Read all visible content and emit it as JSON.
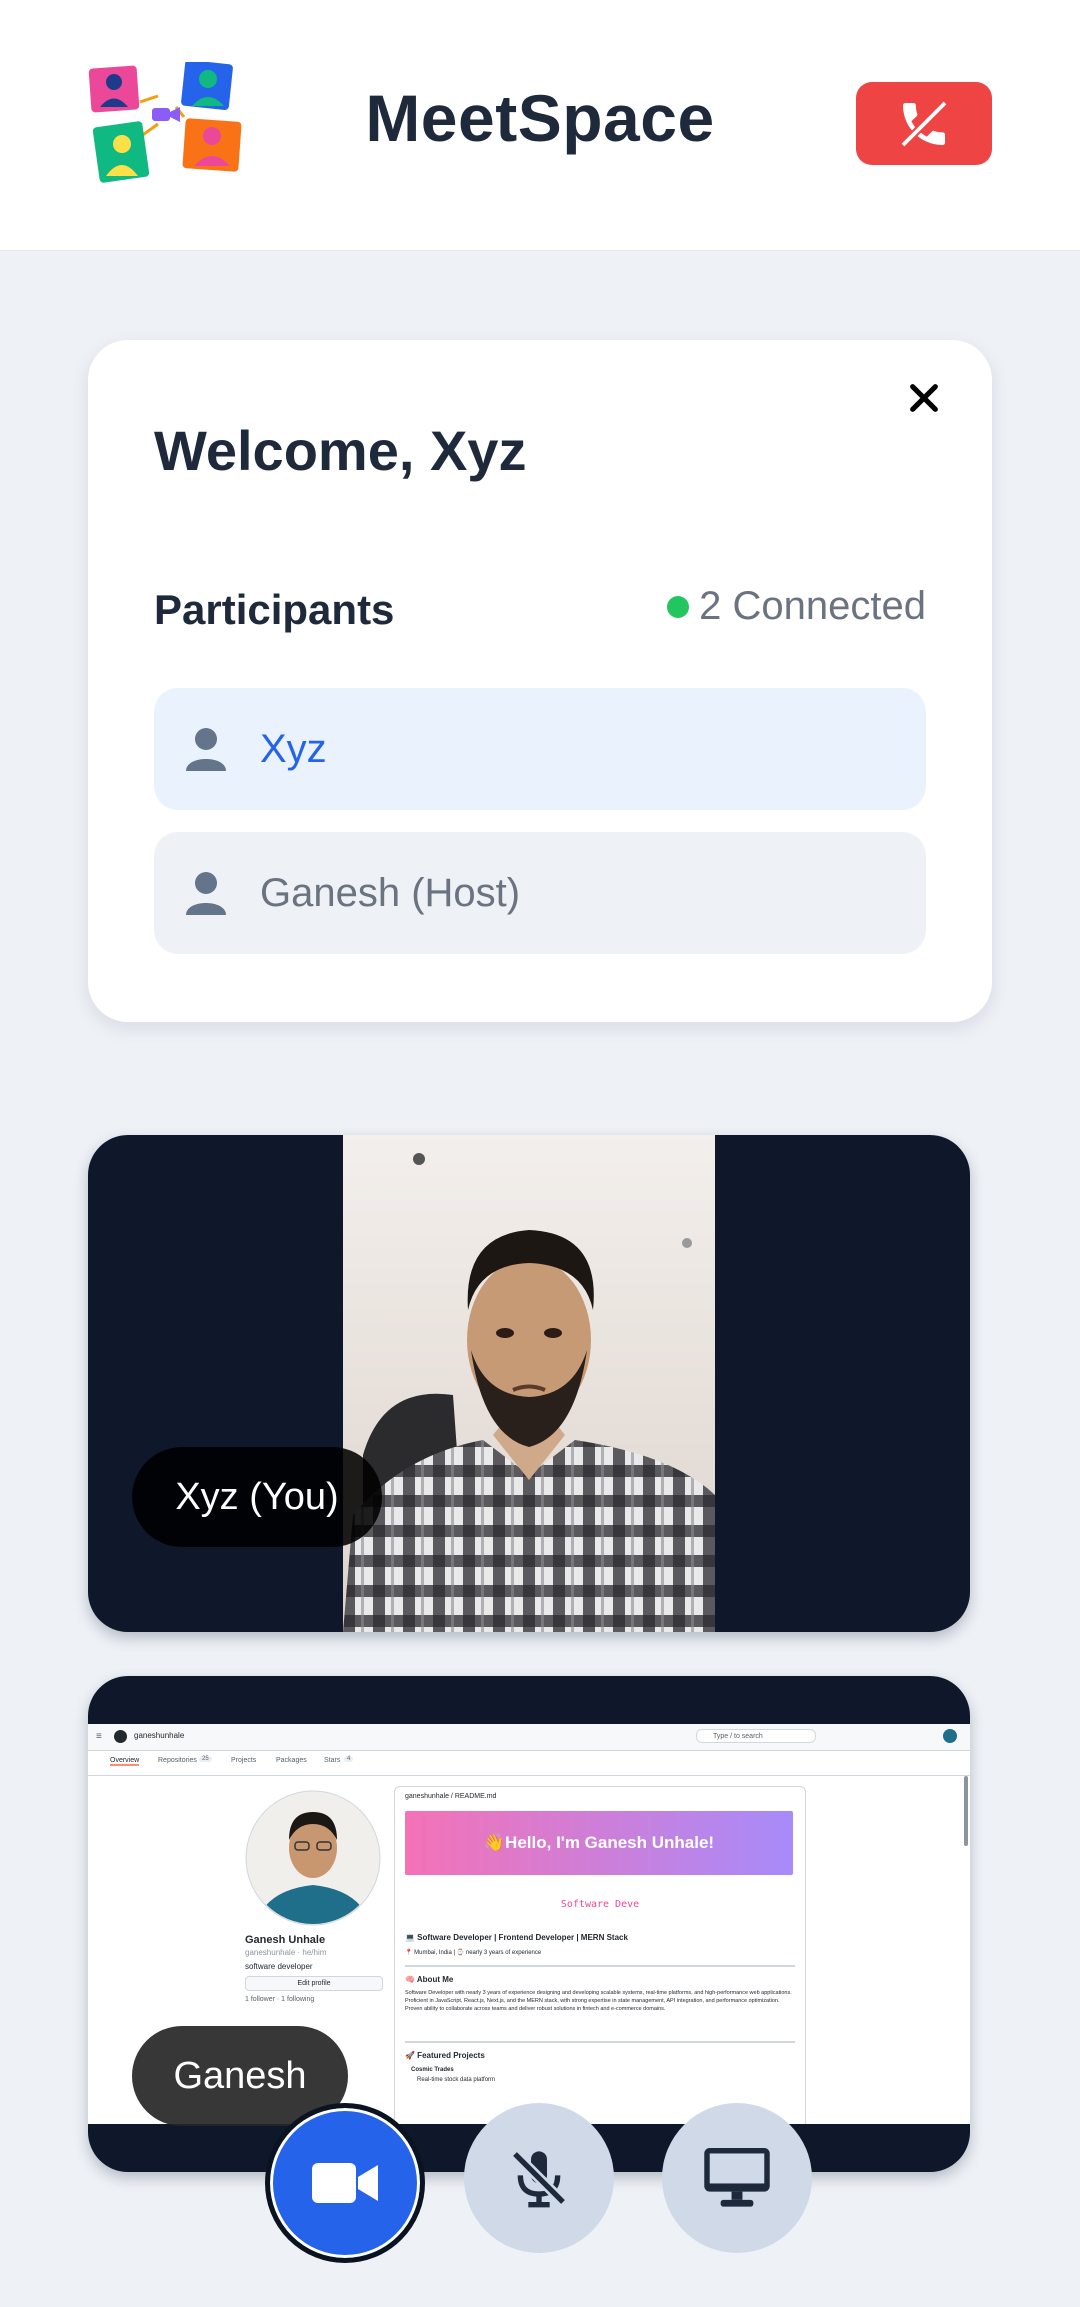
{
  "header": {
    "app_title": "MeetSpace",
    "end_call_icon": "phone-hangup-icon",
    "colors": {
      "end_call": "#ef4444"
    }
  },
  "welcome_card": {
    "greeting": "Welcome, Xyz",
    "participants_title": "Participants",
    "connected_text": "2 Connected",
    "participants": [
      {
        "name": "Xyz",
        "self": true
      },
      {
        "name": "Ganesh (Host)",
        "self": false
      }
    ]
  },
  "videos": {
    "local_label": "Xyz (You)",
    "remote_label": "Ganesh"
  },
  "shared_screen": {
    "username": "ganeshunhale",
    "search_placeholder": "Type / to search",
    "tabs": [
      "Overview",
      "Repositories",
      "Projects",
      "Packages",
      "Stars"
    ],
    "repo_count": "25",
    "stars_count": "4",
    "profile_name": "Ganesh Unhale",
    "profile_handle": "ganeshunhale · he/him",
    "profile_bio": "software developer",
    "edit_profile": "Edit profile",
    "followers_text": "1 follower · 1 following",
    "readme_path": "ganeshunhale / README.md",
    "banner_text": "👋Hello, I'm Ganesh Unhale!",
    "typing_text": "Software Deve",
    "role_line": "💻 Software Developer | Frontend Developer | MERN Stack",
    "location_line": "📍 Mumbai, India | ⌚ nearly 3 years of experience",
    "about_title": "🧠 About Me",
    "about_text": "Software Developer with nearly 3 years of experience designing and developing scalable systems, real-time platforms, and high-performance web applications. Proficient in JavaScript, React.js, Next.js, and the MERN stack, with strong expertise in state management, API integration, and performance optimization. Proven ability to collaborate across teams and deliver robust solutions in fintech and e-commerce domains.",
    "projects_title": "🚀 Featured Projects",
    "project_1": "Cosmic Trades",
    "project_1_desc": "Real-time stock data platform"
  },
  "controls": {
    "video": "video-camera-icon",
    "mic": "microphone-muted-icon",
    "screen": "monitor-icon"
  }
}
